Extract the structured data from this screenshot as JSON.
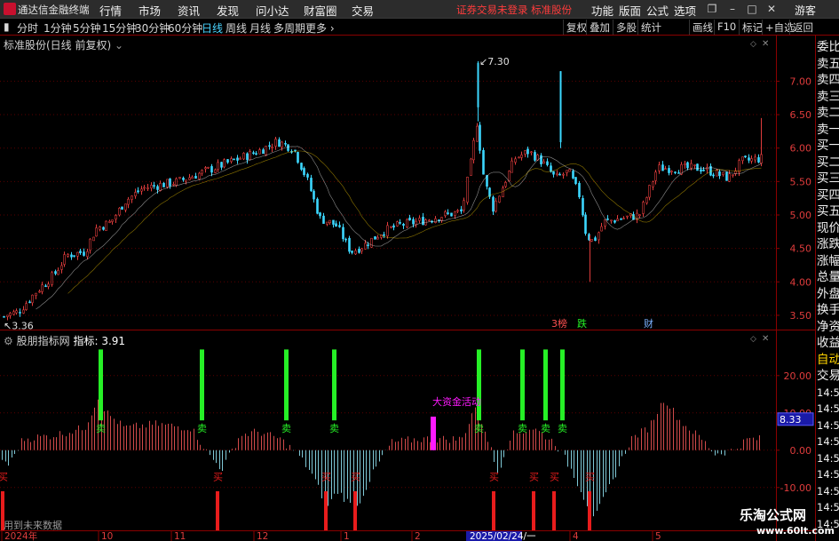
{
  "app": {
    "title": "通达信金融终端",
    "notice": "证券交易未登录  标准股份",
    "guest": "游客"
  },
  "menus": [
    "行情",
    "市场",
    "资讯",
    "发现",
    "问小达",
    "财富圈",
    "交易"
  ],
  "right_menus": [
    "功能",
    "版面",
    "公式",
    "选项"
  ],
  "periods": [
    "分时",
    "1分钟",
    "5分钟",
    "15分钟",
    "30分钟",
    "60分钟",
    "日线",
    "周线",
    "月线",
    "多周期",
    "更多 ›"
  ],
  "active_period": "日线",
  "toolbar_buttons": [
    "复权",
    "叠加",
    "多股",
    "统计",
    "画线",
    "F10",
    "标记",
    "+自选",
    "返回"
  ],
  "stock_label": "标准股份(日线 前复权)",
  "indicator": {
    "name": "股朋指标网",
    "label": "指标:",
    "value": "3.91",
    "current_tag": "8.33",
    "annotation": "大资金活动"
  },
  "future_note": "用到未来数据",
  "right_tabs": [
    "委比",
    "卖五",
    "卖四",
    "卖三",
    "卖二",
    "卖一",
    "买一",
    "买二",
    "买三",
    "买四",
    "买五",
    "现价",
    "涨跌",
    "涨幅",
    "总量",
    "外盘",
    "换手",
    "净资",
    "收益",
    "自动",
    "交易",
    "14:56",
    "14:56",
    "14:56",
    "14:56",
    "14:56",
    "14:56",
    "14:56",
    "14:56",
    "14:56"
  ],
  "watermark": {
    "title": "乐淘公式网",
    "url": "www.60lt.com"
  },
  "chart_data": [
    {
      "type": "candlestick",
      "title": "标准股份(日线 前复权)",
      "y_ticks": [
        "7.00",
        "6.50",
        "6.00",
        "5.50",
        "5.00",
        "4.50",
        "4.00",
        "3.50"
      ],
      "ylim": [
        3.3,
        7.55
      ],
      "annotations": {
        "high": "7.30",
        "low": "3.36"
      },
      "event_markers": [
        "3榜",
        "跌",
        "财"
      ],
      "trend": [
        [
          0,
          3.4
        ],
        [
          5,
          3.5
        ],
        [
          20,
          3.55
        ],
        [
          40,
          3.85
        ],
        [
          60,
          4.1
        ],
        [
          75,
          4.4
        ],
        [
          95,
          4.45
        ],
        [
          108,
          4.8
        ],
        [
          125,
          4.9
        ],
        [
          140,
          5.2
        ],
        [
          160,
          5.4
        ],
        [
          180,
          5.45
        ],
        [
          200,
          5.5
        ],
        [
          230,
          5.65
        ],
        [
          260,
          5.8
        ],
        [
          290,
          5.95
        ],
        [
          312,
          6.1
        ],
        [
          330,
          6.0
        ],
        [
          345,
          5.55
        ],
        [
          360,
          4.95
        ],
        [
          378,
          4.85
        ],
        [
          395,
          4.45
        ],
        [
          410,
          4.55
        ],
        [
          430,
          4.75
        ],
        [
          450,
          4.85
        ],
        [
          470,
          4.9
        ],
        [
          500,
          5.0
        ],
        [
          520,
          5.05
        ],
        [
          530,
          5.8
        ],
        [
          537,
          6.4
        ],
        [
          545,
          5.5
        ],
        [
          555,
          5.1
        ],
        [
          565,
          5.4
        ],
        [
          580,
          5.85
        ],
        [
          595,
          5.95
        ],
        [
          610,
          5.8
        ],
        [
          625,
          5.55
        ],
        [
          640,
          5.65
        ],
        [
          652,
          5.3
        ],
        [
          660,
          4.7
        ],
        [
          668,
          4.6
        ],
        [
          680,
          4.9
        ],
        [
          700,
          4.95
        ],
        [
          720,
          5.0
        ],
        [
          740,
          5.7
        ],
        [
          760,
          5.7
        ],
        [
          790,
          5.7
        ],
        [
          820,
          5.55
        ],
        [
          835,
          5.8
        ],
        [
          858,
          5.85
        ]
      ]
    },
    {
      "type": "bar",
      "title": "股朋指标网",
      "y_ticks": [
        "20.00",
        "10.00",
        "0.00",
        "-10.00"
      ],
      "ylim": [
        -21,
        29
      ],
      "sell_signals": [
        113,
        227,
        322,
        376,
        539,
        588,
        614,
        633
      ],
      "buy_signals": [
        2,
        245,
        367,
        400,
        556,
        601,
        624,
        664
      ],
      "sell_label": "卖",
      "buy_label": "买",
      "wave": [
        [
          0,
          -2
        ],
        [
          10,
          -4
        ],
        [
          25,
          3
        ],
        [
          60,
          4
        ],
        [
          95,
          6
        ],
        [
          110,
          14
        ],
        [
          120,
          10
        ],
        [
          140,
          6
        ],
        [
          175,
          7
        ],
        [
          215,
          6
        ],
        [
          237,
          -2
        ],
        [
          250,
          -5
        ],
        [
          270,
          4
        ],
        [
          290,
          5
        ],
        [
          315,
          3
        ],
        [
          335,
          -1
        ],
        [
          350,
          -6
        ],
        [
          368,
          -15
        ],
        [
          380,
          -11
        ],
        [
          400,
          -16
        ],
        [
          420,
          -6
        ],
        [
          440,
          2
        ],
        [
          470,
          3
        ],
        [
          520,
          3
        ],
        [
          535,
          12
        ],
        [
          548,
          4
        ],
        [
          560,
          -6
        ],
        [
          575,
          4
        ],
        [
          600,
          6
        ],
        [
          625,
          2
        ],
        [
          645,
          -6
        ],
        [
          660,
          -14
        ],
        [
          670,
          -18
        ],
        [
          690,
          -8
        ],
        [
          710,
          3
        ],
        [
          730,
          6
        ],
        [
          748,
          14
        ],
        [
          765,
          8
        ],
        [
          790,
          3
        ],
        [
          805,
          -1
        ],
        [
          825,
          0
        ],
        [
          842,
          3
        ],
        [
          860,
          3
        ]
      ],
      "x_labels": [
        "2024年",
        "10",
        "11",
        "12",
        "1",
        "2",
        "2025/02/24/一",
        "4",
        "5"
      ]
    }
  ],
  "colors": {
    "up": "#e03c3c",
    "down": "#3cd8ff",
    "sell": "#26f026",
    "buy": "#e81c1c",
    "ma": "#ffffff",
    "magenta": "#ff1aff"
  }
}
